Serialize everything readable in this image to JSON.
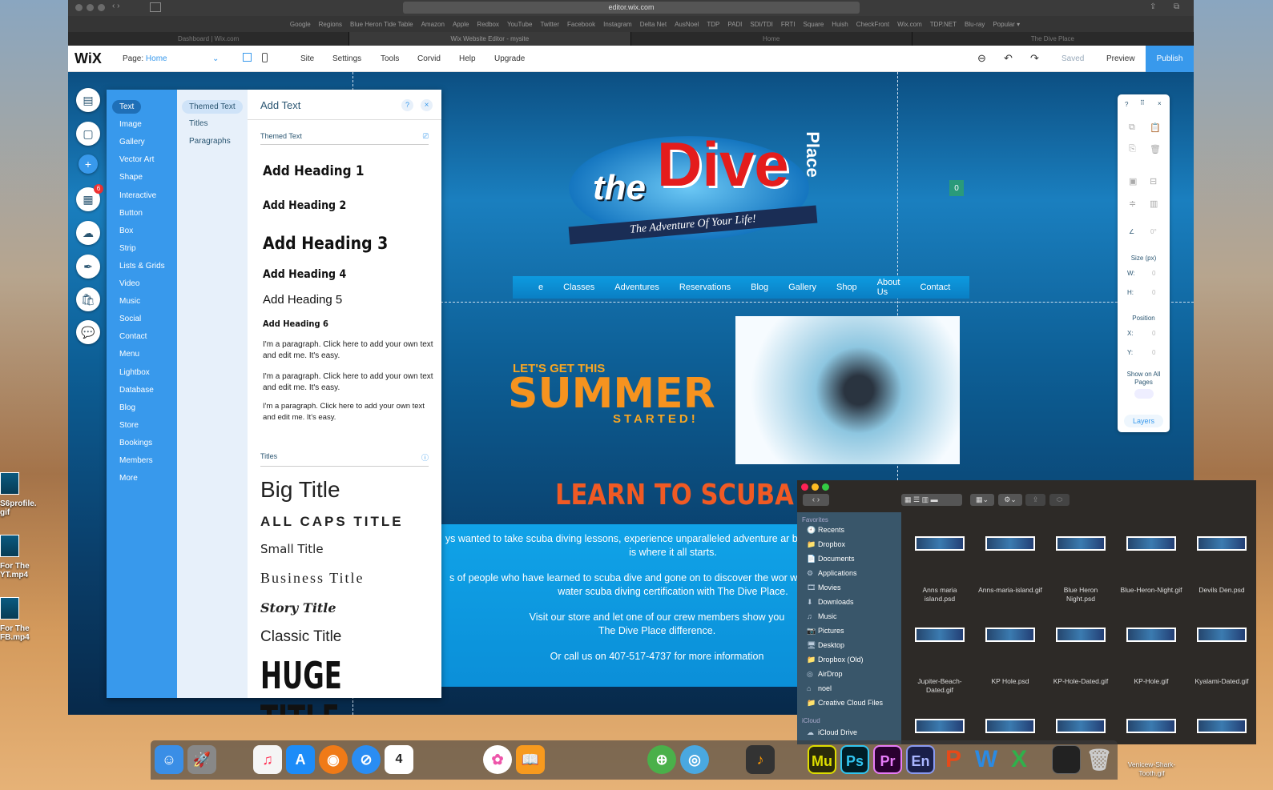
{
  "desktop": {
    "icons": [
      {
        "label": "S6profile.\ngif"
      },
      {
        "label": "For The\nYT.mp4"
      },
      {
        "label": "For The\nFB.mp4"
      }
    ]
  },
  "browser": {
    "url": "editor.wix.com",
    "bookmarks": [
      "Google",
      "Regions",
      "Blue Heron Tide Table",
      "Amazon",
      "Apple",
      "Redbox",
      "YouTube",
      "Twitter",
      "Facebook",
      "Instagram",
      "Delta Net",
      "AusNoel",
      "TDP",
      "PADI",
      "SDI/TDI",
      "FRTI",
      "Square",
      "Huish",
      "CheckFront",
      "Wix.com",
      "TDP.NET",
      "Blu-ray",
      "Popular ▾"
    ],
    "tabs": [
      "Dashboard | Wix.com",
      "Wix Website Editor - mysite",
      "Home",
      "The Dive Place"
    ]
  },
  "wixbar": {
    "logo": "WiX",
    "page_label": "Page:",
    "page_value": "Home",
    "menu": [
      "Site",
      "Settings",
      "Tools",
      "Corvid",
      "Help",
      "Upgrade"
    ],
    "saved": "Saved",
    "preview": "Preview",
    "publish": "Publish"
  },
  "rail": {
    "badge": "6"
  },
  "add_panel": {
    "title": "Add Text",
    "categories": [
      "Text",
      "Image",
      "Gallery",
      "Vector Art",
      "Shape",
      "Interactive",
      "Button",
      "Box",
      "Strip",
      "Lists & Grids",
      "Video",
      "Music",
      "Social",
      "Contact",
      "Menu",
      "Lightbox",
      "Database",
      "Blog",
      "Store",
      "Bookings",
      "Members",
      "More"
    ],
    "subcategories": [
      "Themed Text",
      "Titles",
      "Paragraphs"
    ],
    "themed_section": "Themed Text",
    "headings": [
      "Add Heading 1",
      "Add Heading 2",
      "Add Heading 3",
      "Add Heading 4",
      "Add Heading 5",
      "Add Heading 6"
    ],
    "paragraphs": [
      "I'm a paragraph. Click here to add your own text and edit me. It's easy.",
      "I'm a paragraph. Click here to add your own text and edit me. It's easy.",
      "I'm a paragraph. Click here to add your own text and edit me. It's easy."
    ],
    "titles_section": "Titles",
    "titles": [
      "Big Title",
      "ALL CAPS TITLE",
      "Small Title",
      "Business Title",
      "Story Title",
      "Classic Title",
      "HUGE TITLE"
    ]
  },
  "site": {
    "logo_the": "the",
    "logo_dive": "Dive",
    "logo_place": "Place",
    "tagline": "The Adventure Of Your Life!",
    "cart_count": "0",
    "nav": [
      "e",
      "Classes",
      "Adventures",
      "Reservations",
      "Blog",
      "Gallery",
      "Shop",
      "About Us",
      "Contact"
    ],
    "summer_top": "LET'S GET THIS",
    "summer": "SUMMER",
    "summer_bottom": "STARTED!",
    "headline": "LEARN TO SCUBA DIVE!",
    "paragraphs": [
      "ys wanted to take scuba diving lessons, experience unparalleled adventure ar beneath the waves. This is where it all starts.",
      "s of people who have learned to scuba dive and gone on to discover the wor world. Obtain your open water scuba diving certification with The Dive Place.",
      "Visit our store and let one of our crew members show you The Dive Place difference.",
      "Or call us on 407-517-4737 for more information"
    ]
  },
  "tool_panel": {
    "help": "?",
    "rotation": "0°",
    "size_label": "Size (px)",
    "w_label": "W:",
    "w": "0",
    "h_label": "H:",
    "h": "0",
    "position_label": "Position",
    "x_label": "X:",
    "x": "0",
    "y_label": "Y:",
    "y": "0",
    "show_all": "Show on All Pages",
    "layers": "Layers"
  },
  "finder": {
    "favorites_label": "Favorites",
    "favorites": [
      "Recents",
      "Dropbox",
      "Documents",
      "Applications",
      "Movies",
      "Downloads",
      "Music",
      "Pictures",
      "Desktop",
      "Dropbox (Old)",
      "AirDrop",
      "noel",
      "Creative Cloud Files"
    ],
    "icloud_label": "iCloud",
    "icloud": [
      "iCloud Drive"
    ],
    "files": [
      "Anns maria island.psd",
      "Anns-maria-island.gif",
      "Blue Heron Night.psd",
      "Blue-Heron-Night.gif",
      "Devils Den.psd",
      "Jupiter-Beach-Dated.gif",
      "KP Hole.psd",
      "KP-Hole-Dated.gif",
      "KP-Hole.gif",
      "Kyalami-Dated.gif",
      "",
      "",
      "",
      "",
      ""
    ],
    "overflow_label": "Venicew-Shark-Tooth.gif"
  },
  "dock": {
    "calendar_day": "4",
    "apps": [
      "Mu",
      "Ps",
      "Pr",
      "En"
    ]
  }
}
